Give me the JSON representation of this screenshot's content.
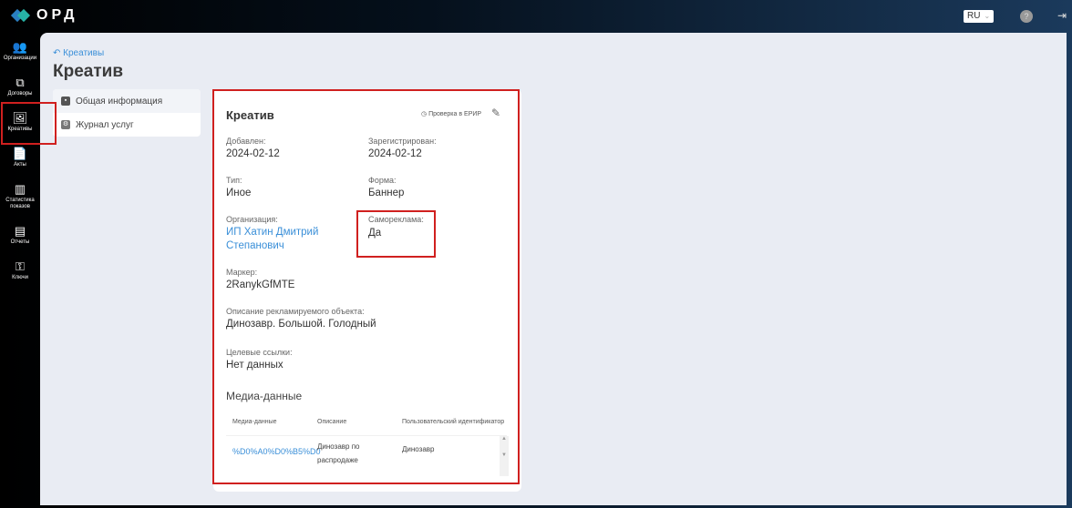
{
  "app": {
    "logo": "ОРД",
    "lang": "RU",
    "help": "?"
  },
  "sidebar": {
    "items": [
      {
        "label": "Организации",
        "icon": "users-icon",
        "glyph": "👥"
      },
      {
        "label": "Договоры",
        "icon": "documents-icon",
        "glyph": "⧉"
      },
      {
        "label": "Креативы",
        "icon": "image-icon",
        "glyph": "🖼"
      },
      {
        "label": "Акты",
        "icon": "file-icon",
        "glyph": "📄"
      },
      {
        "label": "Статистика показов",
        "icon": "stats-icon",
        "glyph": "▥"
      },
      {
        "label": "Отчеты",
        "icon": "report-icon",
        "glyph": "▤"
      },
      {
        "label": "Ключи",
        "icon": "key-icon",
        "glyph": "⚿"
      }
    ]
  },
  "breadcrumb": {
    "back": "Креативы"
  },
  "page": {
    "title": "Креатив"
  },
  "tabs": [
    {
      "label": "Общая информация"
    },
    {
      "label": "Журнал услуг"
    }
  ],
  "card": {
    "title": "Креатив",
    "erir": "Проверка в ЕРИР",
    "fields": {
      "added": {
        "label": "Добавлен",
        "value": "2024-02-12"
      },
      "registered": {
        "label": "Зарегистрирован",
        "value": "2024-02-12"
      },
      "type": {
        "label": "Тип",
        "value": "Иное"
      },
      "form": {
        "label": "Форма",
        "value": "Баннер"
      },
      "org": {
        "label": "Организация",
        "value": "ИП Хатин Дмитрий Степанович"
      },
      "selfad": {
        "label": "Самореклама",
        "value": "Да"
      },
      "marker": {
        "label": "Маркер",
        "value": "2RanykGfMTE"
      },
      "desc": {
        "label": "Описание рекламируемого объекта",
        "value": "Динозавр. Большой. Голодный"
      },
      "links": {
        "label": "Целевые ссылки",
        "value": "Нет данных"
      }
    },
    "media": {
      "title": "Медиа-данные",
      "columns": [
        "Медиа-данные",
        "Описание",
        "Пользовательский идентификатор"
      ],
      "rows": [
        [
          "%D0%A0%D0%B5%D0",
          "Динозавр по распродаже",
          "Динозавр"
        ]
      ]
    }
  }
}
